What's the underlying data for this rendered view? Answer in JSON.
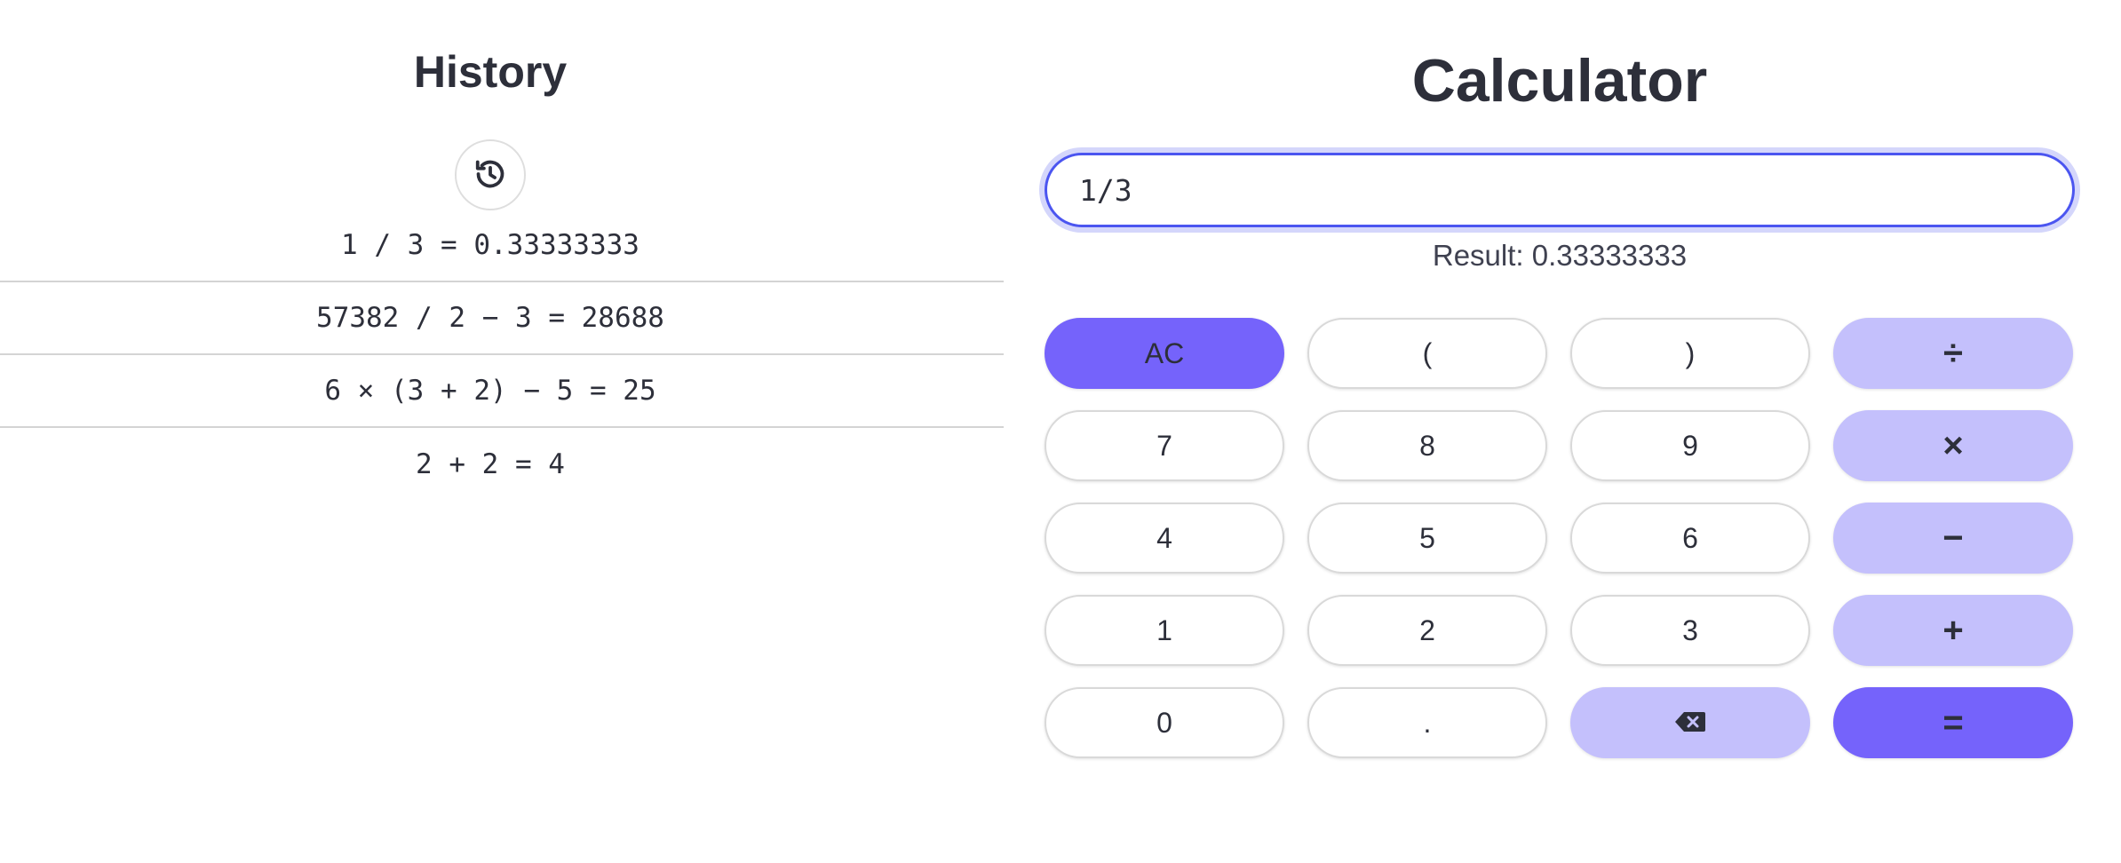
{
  "colors": {
    "accent": "#7563fb",
    "operator_bg": "#c4c0fc",
    "input_border": "#4b55f0",
    "text": "#2d2f3a"
  },
  "history": {
    "title": "History",
    "history_button_icon": "history-icon",
    "items": [
      "1 / 3 = 0.33333333",
      "57382 / 2 − 3 = 28688",
      "6 × (3 + 2) − 5 = 25",
      "2 + 2 = 4"
    ]
  },
  "calculator": {
    "title": "Calculator",
    "expression": "1/3",
    "result_text": "Result: 0.33333333",
    "keys": {
      "clear": "AC",
      "open_paren": "(",
      "close_paren": ")",
      "divide": "÷",
      "seven": "7",
      "eight": "8",
      "nine": "9",
      "multiply": "×",
      "four": "4",
      "five": "5",
      "six": "6",
      "subtract": "−",
      "one": "1",
      "two": "2",
      "three": "3",
      "add": "+",
      "zero": "0",
      "decimal": ".",
      "backspace_icon": "backspace-icon",
      "equals": "="
    }
  }
}
